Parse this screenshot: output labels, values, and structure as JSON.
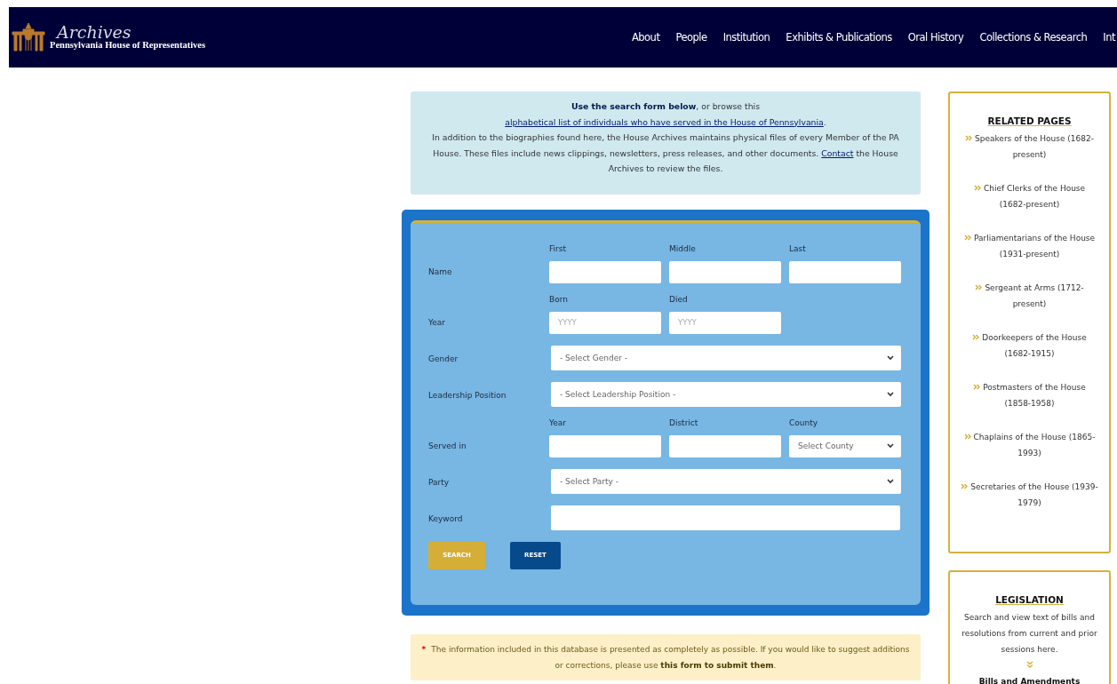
{
  "header": {
    "logo_title": "Archives",
    "logo_subtitle": "Pennsylvania House of Representatives",
    "nav": [
      "About",
      "People",
      "Institution",
      "Exhibits & Publications",
      "Oral History",
      "Collections & Research",
      "Int"
    ]
  },
  "intro": {
    "before": "**Use the search form below**, or browse this ",
    "link": "alphabetical list of individuals who have served in the House of Pennsylvania",
    "after": ".",
    "text": "In addition to the biographies found here, the House Archives maintains physical files of every Member of the PA House. These files include news clippings, newsletters, press releases, and other documents. ",
    "contact_link": "Contact",
    "contact_after": " the House Archives to review the files."
  },
  "form": {
    "rows": [
      {
        "kind": "inputs",
        "label": "Name",
        "fields": [
          {
            "kind": "text",
            "caption": "First"
          },
          {
            "kind": "text",
            "caption": "Middle"
          },
          {
            "kind": "text",
            "caption": "Last"
          }
        ]
      },
      {
        "kind": "inputs",
        "label": "Year",
        "fields": [
          {
            "kind": "text",
            "caption": "Born",
            "placeholder": "YYYY"
          },
          {
            "kind": "text",
            "caption": "Died",
            "placeholder": "YYYY"
          }
        ]
      },
      {
        "kind": "select",
        "label": "Gender",
        "value": "- Select Gender -"
      },
      {
        "kind": "select",
        "label": "Leadership Position",
        "value": "- Select Leadership Position -"
      },
      {
        "kind": "inputs",
        "label": "Served in",
        "fields": [
          {
            "kind": "text",
            "caption": "Year"
          },
          {
            "kind": "text",
            "caption": "District"
          },
          {
            "kind": "select",
            "caption": "County",
            "value": "Select County"
          }
        ]
      },
      {
        "kind": "select",
        "label": "Party",
        "value": "- Select Party -"
      },
      {
        "kind": "text",
        "label": "Keyword"
      }
    ],
    "buttons": [
      {
        "kind": "primary",
        "label": "SEARCH"
      },
      {
        "kind": "secondary",
        "label": "RESET"
      }
    ]
  },
  "notice": {
    "mark": "*",
    "before": "The information included in this database is presented as completely as possible. If you would like to suggest additions or corrections, please use ",
    "link": "this form to submit them",
    "after": "."
  },
  "related": {
    "title": "RELATED PAGES",
    "items": [
      {
        "label": "Speakers of the House (1682-present)"
      },
      {
        "label": "Chief Clerks of the House (1682-present)"
      },
      {
        "label": "Parliamentarians of the House (1931-present)"
      },
      {
        "label": "Sergeant at Arms (1712-present)"
      },
      {
        "label": "Doorkeepers of the House (1682-1915)"
      },
      {
        "label": "Postmasters of the House (1858-1958)"
      },
      {
        "label": "Chaplains of the House (1865-1993)"
      },
      {
        "label": "Secretaries of the House (1939-1979)"
      }
    ]
  },
  "legislation": {
    "title": "LEGISLATION",
    "text": "Search and view text of bills and resolutions from current and prior sessions here.",
    "link": "Bills and Amendments"
  }
}
